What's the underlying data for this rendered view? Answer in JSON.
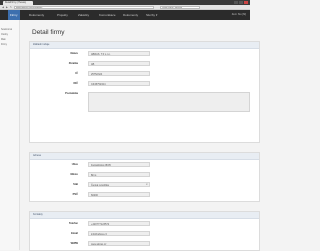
{
  "browser": {
    "tab_title": "Detail firmy | Hesasy",
    "address": "www.filmfirm.cz/firmy/detail",
    "search": "Detail firmy | Hesasy"
  },
  "navbar": {
    "items": [
      "Firmy",
      "Dokumenty",
      "Projekty",
      "Zakázky",
      "Komunikace",
      "Dokumenty",
      "Sluzby ▾"
    ],
    "active_index": 0,
    "user": "Zern Sto [M]"
  },
  "sidebar": {
    "items": [
      "Soukromá",
      "Osoby",
      "Mak",
      "Firmy"
    ]
  },
  "page": {
    "title": "Detail firmy"
  },
  "sections": [
    {
      "header": "Základní údaje",
      "fields": [
        {
          "label": "Název",
          "value": "ABRAS, T.F s.r.o."
        },
        {
          "label": "Zkratka",
          "value": "AB"
        },
        {
          "label": "IČ",
          "value": "25752324"
        },
        {
          "label": "DIČ",
          "value": "CZ45752324"
        },
        {
          "label": "Poznámka",
          "value": ""
        }
      ]
    },
    {
      "header": "Adresa",
      "fields": [
        {
          "label": "Ulice",
          "value": "Fantaštická 28/05"
        },
        {
          "label": "Město",
          "value": "Brno"
        },
        {
          "label": "Stát",
          "value": "Česká republika"
        },
        {
          "label": "PSČ",
          "value": "60200"
        }
      ]
    },
    {
      "header": "Kontakty",
      "fields": [
        {
          "label": "Telefon",
          "value": "+420777123572"
        },
        {
          "label": "Email",
          "value": "info@abras.cz"
        },
        {
          "label": "WWW",
          "value": "www.abras.cz"
        }
      ]
    }
  ]
}
